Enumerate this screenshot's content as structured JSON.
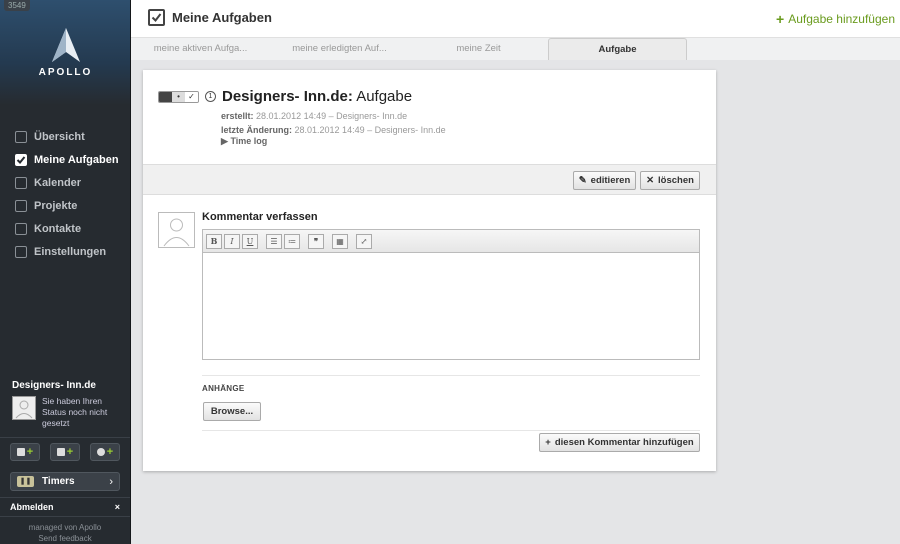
{
  "sidebar": {
    "version": "3549",
    "logo_text": "APOLLO",
    "nav": [
      {
        "label": "Übersicht",
        "icon": "dashboard-icon"
      },
      {
        "label": "Meine Aufgaben",
        "icon": "checkbox-icon"
      },
      {
        "label": "Kalender",
        "icon": "calendar-icon"
      },
      {
        "label": "Projekte",
        "icon": "projects-icon"
      },
      {
        "label": "Kontakte",
        "icon": "contacts-icon"
      },
      {
        "label": "Einstellungen",
        "icon": "settings-icon"
      }
    ],
    "user_name": "Designers- Inn.de",
    "user_status": "Sie haben Ihren Status noch nicht gesetzt",
    "timers_label": "Timers",
    "logout_label": "Abmelden",
    "logout_close": "×",
    "managed_by": "managed von Apollo",
    "feedback": "Send feedback"
  },
  "header": {
    "title": "Meine Aufgaben",
    "add_label": "Aufgabe hinzufügen",
    "tabs": [
      {
        "label": "meine aktiven Aufga..."
      },
      {
        "label": "meine erledigten Auf..."
      },
      {
        "label": "meine Zeit"
      },
      {
        "label": "Aufgabe"
      }
    ]
  },
  "task": {
    "project": "Designers- Inn.de:",
    "name": "Aufgabe",
    "created_label": "erstellt:",
    "created_value": "28.01.2012 14:49 – Designers- Inn.de",
    "changed_label": "letzte Änderung:",
    "changed_value": "28.01.2012 14:49 – Designers- Inn.de",
    "timelog": "Time log",
    "edit_label": "editieren",
    "delete_label": "löschen"
  },
  "comment": {
    "title": "Kommentar verfassen",
    "attachments_label": "ANHÄNGE",
    "browse_label": "Browse...",
    "submit_label": "diesen Kommentar hinzufügen"
  },
  "colors": {
    "accent_green": "#6a9b1e",
    "sidebar_bg": "#262b30"
  }
}
